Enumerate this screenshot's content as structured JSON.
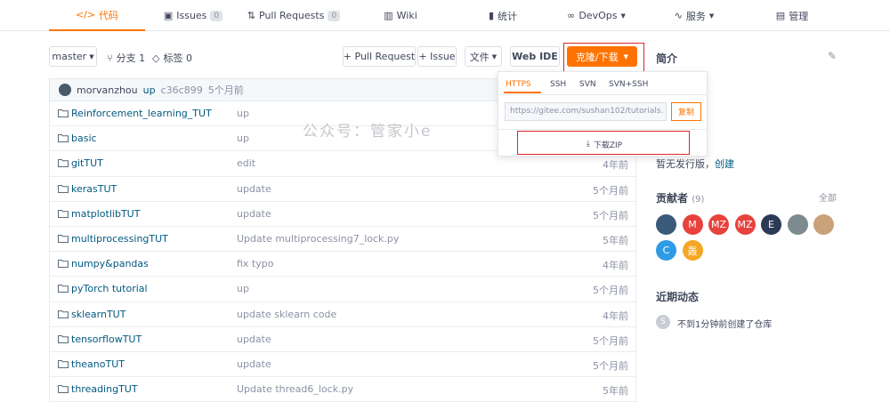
{
  "nav": {
    "tabs": [
      {
        "label": "代码",
        "icon": "code-icon"
      },
      {
        "label": "Issues",
        "count": "0",
        "icon": "issues-icon"
      },
      {
        "label": "Pull Requests",
        "count": "0",
        "icon": "pull-request-icon"
      },
      {
        "label": "Wiki",
        "icon": "wiki-icon"
      },
      {
        "label": "统计",
        "icon": "stats-icon"
      },
      {
        "label": "DevOps",
        "icon": "devops-icon"
      },
      {
        "label": "服务",
        "icon": "service-icon"
      },
      {
        "label": "管理",
        "icon": "manage-icon"
      }
    ]
  },
  "toolbar": {
    "branch": "master",
    "branches_label": "分支 1",
    "tags_label": "标签 0",
    "pull_request_btn": "+ Pull Request",
    "issue_btn": "+ Issue",
    "file_btn": "文件",
    "webide_btn": "Web IDE",
    "clone_btn": "克隆/下载"
  },
  "commit": {
    "author": "morvanzhou",
    "message": "up",
    "hash": "c36c899",
    "time": "5个月前"
  },
  "files": [
    {
      "name": "Reinforcement_learning_TUT",
      "msg": "up",
      "time": ""
    },
    {
      "name": "basic",
      "msg": "up",
      "time": ""
    },
    {
      "name": "gitTUT",
      "msg": "edit",
      "time": "4年前"
    },
    {
      "name": "kerasTUT",
      "msg": "update",
      "time": "5个月前"
    },
    {
      "name": "matplotlibTUT",
      "msg": "update",
      "time": "5个月前"
    },
    {
      "name": "multiprocessingTUT",
      "msg": "Update multiprocessing7_lock.py",
      "time": "5年前"
    },
    {
      "name": "numpy&pandas",
      "msg": "fix typo",
      "time": "4年前"
    },
    {
      "name": "pyTorch tutorial",
      "msg": "up",
      "time": "5个月前"
    },
    {
      "name": "sklearnTUT",
      "msg": "update sklearn code",
      "time": "4年前"
    },
    {
      "name": "tensorflowTUT",
      "msg": "update",
      "time": "5个月前"
    },
    {
      "name": "theanoTUT",
      "msg": "update",
      "time": "5个月前"
    },
    {
      "name": "threadingTUT",
      "msg": "Update thread6_lock.py",
      "time": "5年前"
    }
  ],
  "clone": {
    "protocols": [
      "HTTPS",
      "SSH",
      "SVN",
      "SVN+SSH"
    ],
    "active": "HTTPS",
    "url": "https://gitee.com/sushan102/tutorials.",
    "copy_btn": "复制",
    "download_zip": "下载ZIP"
  },
  "watermark": "公众号：管家小e",
  "sidebar": {
    "intro_title": "简介",
    "release_text": "暂无发行版，",
    "release_link": "创建",
    "contributors_title": "贡献者",
    "contributors_count": "(9)",
    "contributors_all": "全部",
    "contributors": [
      {
        "label": "",
        "color": "#3b5a7a"
      },
      {
        "label": "M",
        "color": "#e8423c"
      },
      {
        "label": "MZ",
        "color": "#e8423c"
      },
      {
        "label": "MZ",
        "color": "#e8423c"
      },
      {
        "label": "E",
        "color": "#2b3a55"
      },
      {
        "label": "",
        "color": "#7d8a8f"
      },
      {
        "label": "",
        "color": "#c9a27a"
      },
      {
        "label": "C",
        "color": "#2e9be6"
      },
      {
        "label": "轰",
        "color": "#f5a623"
      }
    ],
    "activity_title": "近期动态",
    "activity_avatar": "S",
    "activity_text": "不到1分钟前创建了仓库"
  },
  "colors": {
    "accent": "#fe7300",
    "link": "#005980",
    "highlight": "#e0242c"
  }
}
